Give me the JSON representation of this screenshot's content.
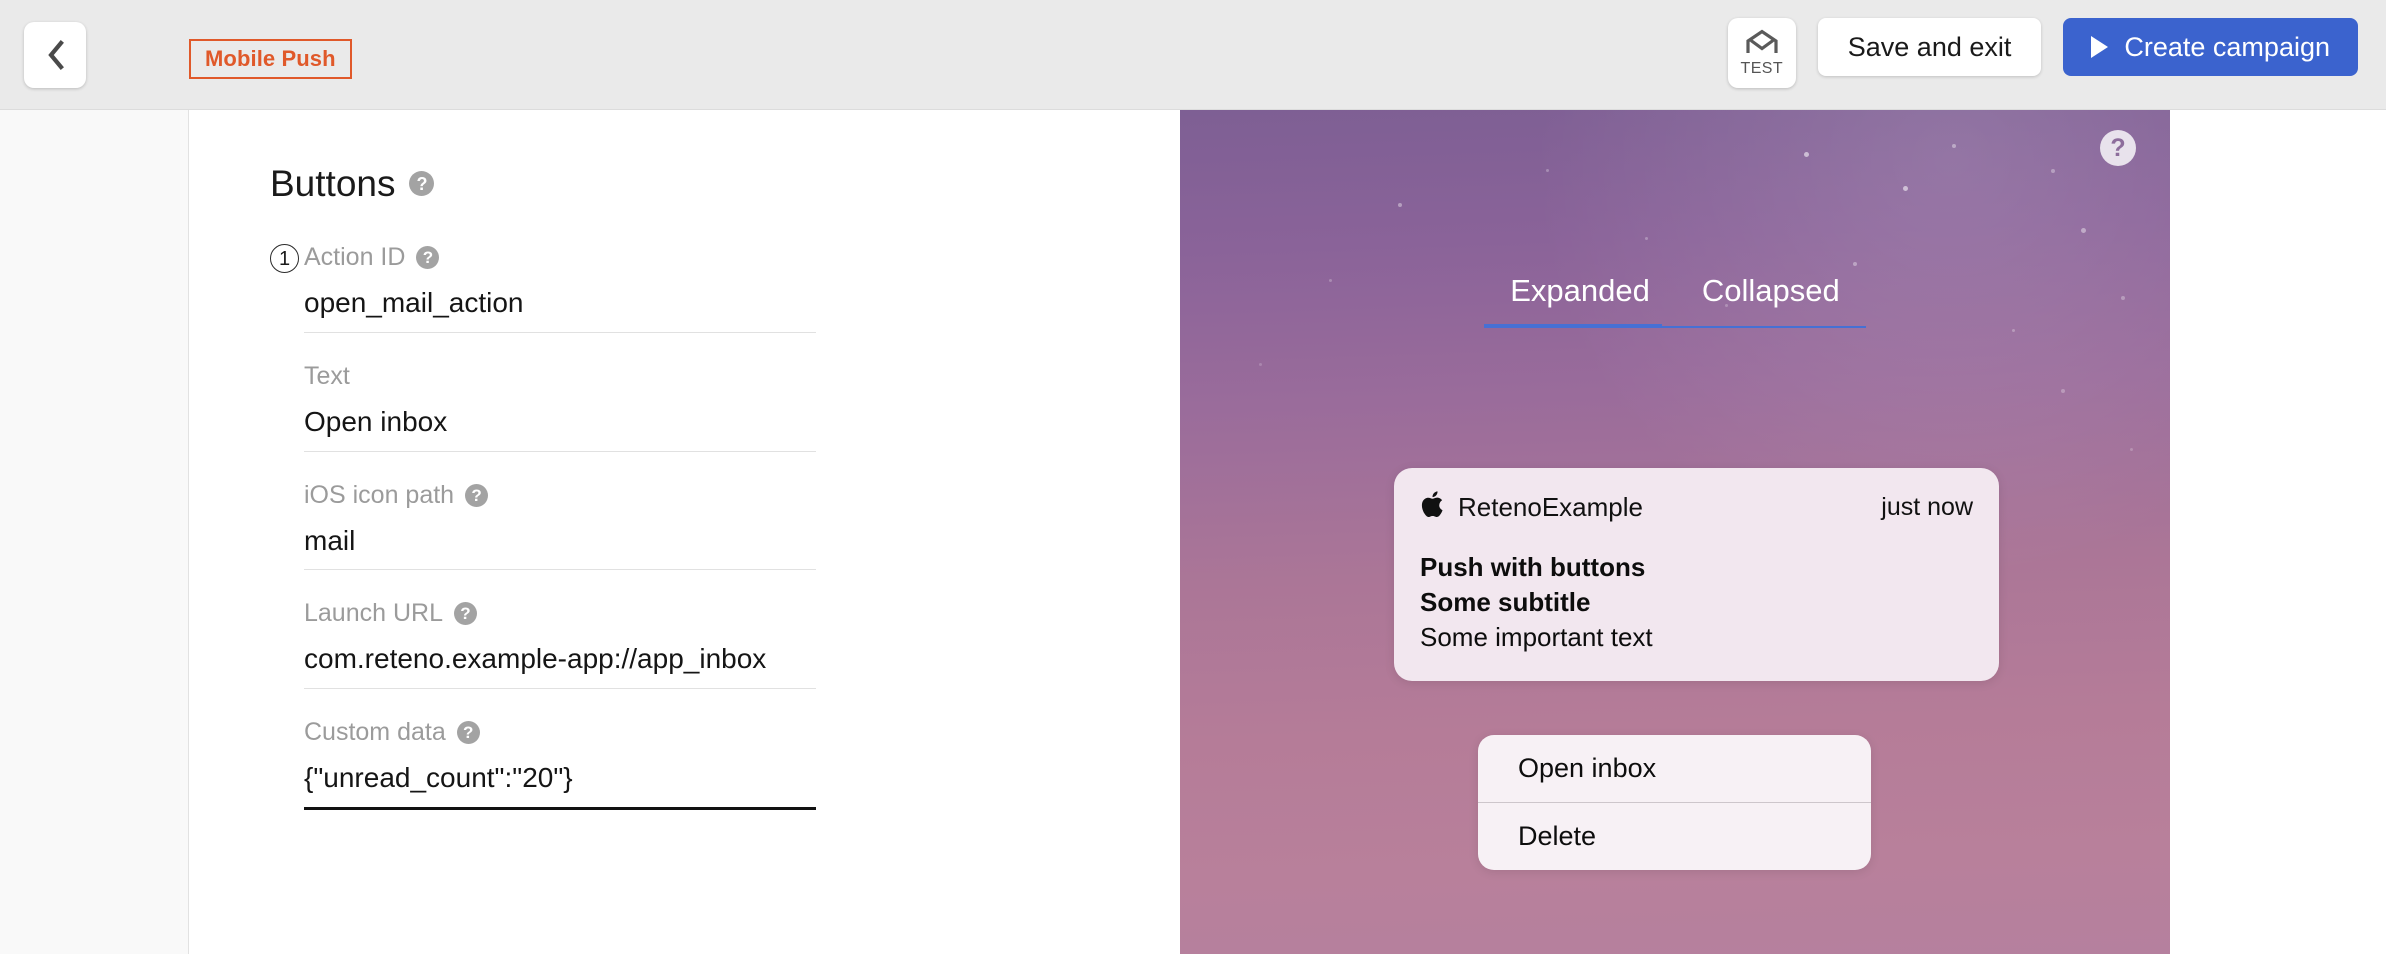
{
  "topbar": {
    "back_icon": "chevron-left-icon",
    "channel_badge": "Mobile Push",
    "test_button": {
      "icon": "envelope-icon",
      "label": "TEST"
    },
    "save_exit_label": "Save and exit",
    "create_campaign_label": "Create campaign",
    "create_campaign_icon": "play-triangle-icon",
    "primary_color": "#3b63ce",
    "badge_color": "#e0592a"
  },
  "form": {
    "section_title": "Buttons",
    "section_help_icon": "question-mark-icon",
    "action_number": "1",
    "fields": [
      {
        "label": "Action ID",
        "help": true,
        "value": "open_mail_action",
        "focused": false
      },
      {
        "label": "Text",
        "help": false,
        "value": "Open inbox",
        "focused": false
      },
      {
        "label": "iOS icon path",
        "help": true,
        "value": "mail",
        "focused": false
      },
      {
        "label": "Launch URL",
        "help": true,
        "value": "com.reteno.example-app://app_inbox",
        "focused": false
      },
      {
        "label": "Custom data",
        "help": true,
        "value": "{\"unread_count\":\"20\"}",
        "focused": true
      }
    ]
  },
  "preview": {
    "help_icon": "question-mark-icon",
    "tabs": [
      {
        "label": "Expanded",
        "active": true
      },
      {
        "label": "Collapsed",
        "active": false
      }
    ],
    "tab_indicator_color": "#4670d4",
    "notification": {
      "brand_icon": "apple-logo-icon",
      "app_name": "RetenoExample",
      "time": "just now",
      "title": "Push with buttons",
      "subtitle": "Some subtitle",
      "body": "Some important text"
    },
    "actions": [
      {
        "label": "Open inbox"
      },
      {
        "label": "Delete"
      }
    ],
    "background_gradient_from": "#7e5f94",
    "background_gradient_to": "#b5809e"
  }
}
